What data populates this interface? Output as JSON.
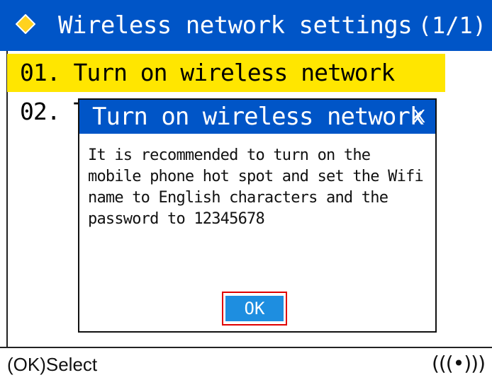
{
  "header": {
    "icon": "diamond-icon",
    "title": "Wireless network settings",
    "page_indicator": "(1/1)"
  },
  "menu": {
    "items": [
      {
        "label": "01. Turn on wireless network",
        "selected": true
      },
      {
        "label": "02. T",
        "selected": false
      }
    ]
  },
  "dialog": {
    "title": "Turn on wireless network",
    "close_label": "X",
    "message": "It is recommended to turn on the mobile phone hot spot and set the Wifi name to English characters and the password to 12345678",
    "ok_label": "OK"
  },
  "footer": {
    "hint": "(OK)Select",
    "wireless_icon": "(((•)))"
  },
  "colors": {
    "header_bg": "#0055c7",
    "selected_bg": "#ffe600",
    "ok_button_bg": "#1e8ee0",
    "ok_focus_border": "#e00000",
    "diamond_fill": "#ffd21f"
  }
}
